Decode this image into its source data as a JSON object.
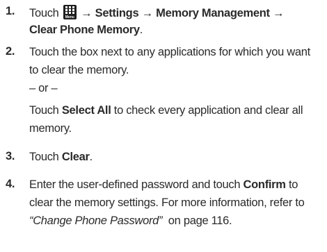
{
  "icons": {
    "menu": "menu-grid-icon",
    "arrow": "→"
  },
  "steps": [
    {
      "number": "1.",
      "touch": "Touch",
      "menu_icon_caption": "Menu",
      "settings": "Settings",
      "memory_management": "Memory Management",
      "clear_phone_memory": "Clear Phone Memory",
      "period": "."
    },
    {
      "number": "2.",
      "line1": "Touch the box next to any applications for which you want",
      "line2": "to clear the memory.",
      "or": "– or –",
      "line3_pre": "Touch ",
      "select_all": "Select All",
      "line3_post": " to check every application and clear all",
      "line4": "memory."
    },
    {
      "number": "3.",
      "pre": "Touch ",
      "clear": "Clear",
      "post": "."
    },
    {
      "number": "4.",
      "line1_pre": "Enter the user-defined password and touch ",
      "confirm": "Confirm",
      "line1_post": " to",
      "line2": "clear the memory settings. For more information, refer to",
      "link": "“Change Phone Password”",
      "line3_post": "  on page 116."
    }
  ]
}
